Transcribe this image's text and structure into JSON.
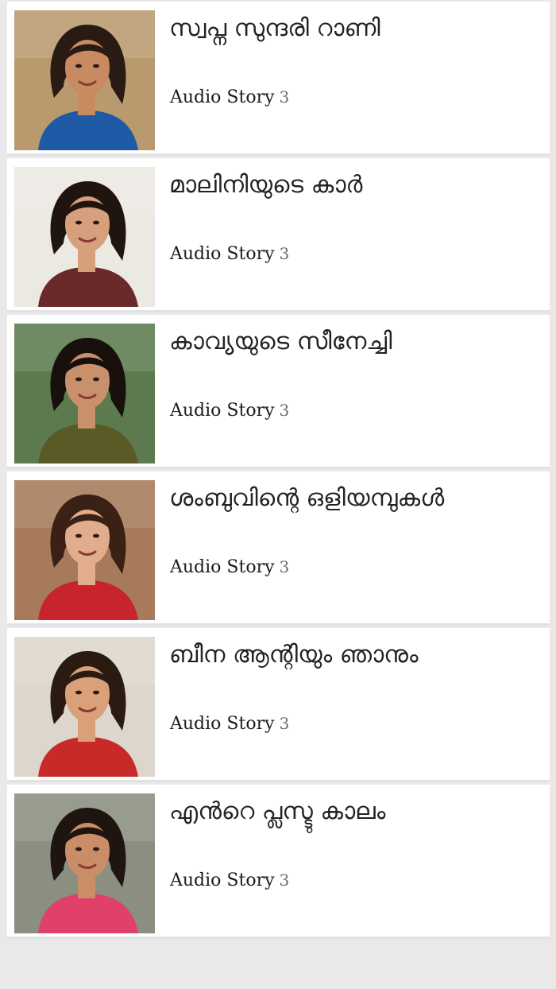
{
  "stories": [
    {
      "title": "സ്വപ്ന സുന്ദരി റാണി",
      "type_label": "Audio Story",
      "number": "3",
      "photo_colors": {
        "bg": "#b99a6f",
        "hair": "#2a1a14",
        "skin": "#c88a60",
        "outfit": "#1f5aa6"
      }
    },
    {
      "title": "മാലിനിയുടെ കാർ",
      "type_label": "Audio Story",
      "number": "3",
      "photo_colors": {
        "bg": "#ece8e2",
        "hair": "#1f1410",
        "skin": "#d6a07c",
        "outfit": "#6b2a2a"
      }
    },
    {
      "title": "കാവ്യയുടെ സീനേച്ചി",
      "type_label": "Audio Story",
      "number": "3",
      "photo_colors": {
        "bg": "#5d7a4e",
        "hair": "#17100d",
        "skin": "#c9906c",
        "outfit": "#5a5a26"
      }
    },
    {
      "title": "ശംബുവിന്റെ ഒളിയമ്പുകൾ",
      "type_label": "Audio Story",
      "number": "3",
      "photo_colors": {
        "bg": "#a77a5a",
        "hair": "#3a2015",
        "skin": "#e2ad8c",
        "outfit": "#c8242b"
      }
    },
    {
      "title": "ബീന ആന്റിയും ഞാനും",
      "type_label": "Audio Story",
      "number": "3",
      "photo_colors": {
        "bg": "#ddd6cc",
        "hair": "#2b1a12",
        "skin": "#d9a07a",
        "outfit": "#c82a2a"
      }
    },
    {
      "title": "എൻറെ പ്ലസ്ടു കാലം",
      "type_label": "Audio Story",
      "number": "3",
      "photo_colors": {
        "bg": "#8a8f80",
        "hair": "#1e1410",
        "skin": "#c98e68",
        "outfit": "#e0406a"
      }
    }
  ]
}
